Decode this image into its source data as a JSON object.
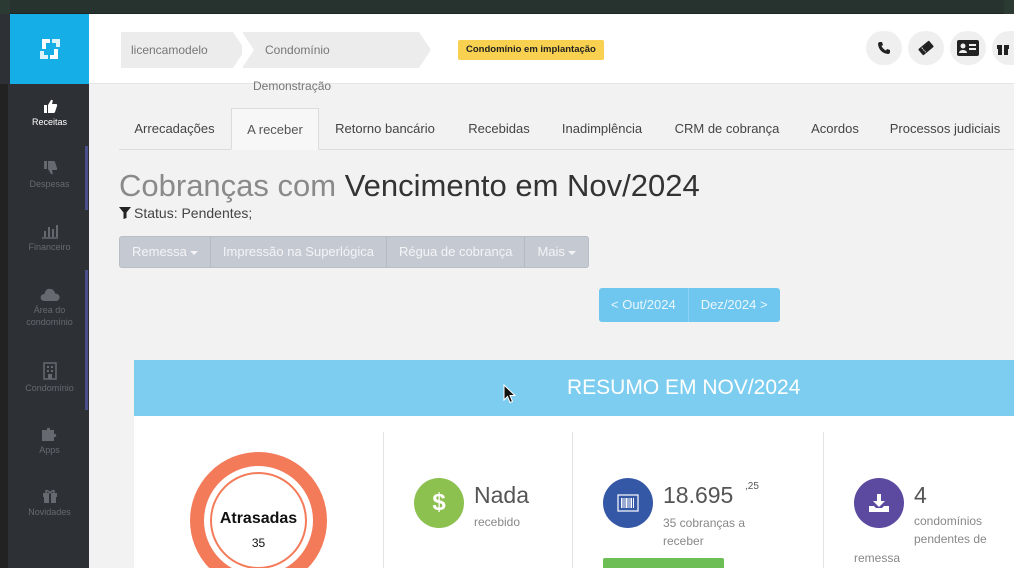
{
  "sidebar": {
    "items": [
      {
        "label": "Receitas",
        "icon": "thumbs-up-icon"
      },
      {
        "label": "Despesas",
        "icon": "thumbs-down-icon"
      },
      {
        "label": "Financeiro",
        "icon": "bar-chart-icon"
      },
      {
        "label": "Área do condomínio",
        "icon": "cloud-icon"
      },
      {
        "label": "Condomínio",
        "icon": "building-icon"
      },
      {
        "label": "Apps",
        "icon": "puzzle-icon"
      },
      {
        "label": "Novidades",
        "icon": "gift-icon"
      }
    ]
  },
  "header": {
    "breadcrumb": [
      "licencamodelo",
      "Condomínio Demonstração"
    ],
    "badge": "Condomínio em implantação"
  },
  "tabs": [
    "Arrecadações",
    "A receber",
    "Retorno bancário",
    "Recebidas",
    "Inadimplência",
    "CRM de cobrança",
    "Acordos",
    "Processos judiciais"
  ],
  "page": {
    "title_light": "Cobranças com",
    "title_dark": "Vencimento em Nov/2024",
    "status": "Status: Pendentes;"
  },
  "actions": {
    "remessa": "Remessa",
    "impressao": "Impressão na Superlógica",
    "regua": "Régua de cobrança",
    "mais": "Mais"
  },
  "pager": {
    "prev": "< Out/2024",
    "next": "Dez/2024 >"
  },
  "summary": {
    "heading": "RESUMO EM NOV/2024",
    "atrasadas_label": "Atrasadas",
    "atrasadas_count": "35",
    "recebido_value": "Nada",
    "recebido_label": "recebido",
    "receber_value": "18.695",
    "receber_cents": ",25",
    "receber_label": "35 cobranças a receber",
    "remessa_value": "4",
    "remessa_label": "condomínios pendentes de",
    "remessa_label2": "remessa"
  },
  "colors": {
    "brand": "#16aee6",
    "summary_header": "#7dcdf0",
    "overdue_ring": "#f47b5a",
    "received_icon": "#8cc04f",
    "receivable_icon": "#3558a6",
    "remittance_icon": "#5b4aa0",
    "badge": "#f7d14f"
  }
}
